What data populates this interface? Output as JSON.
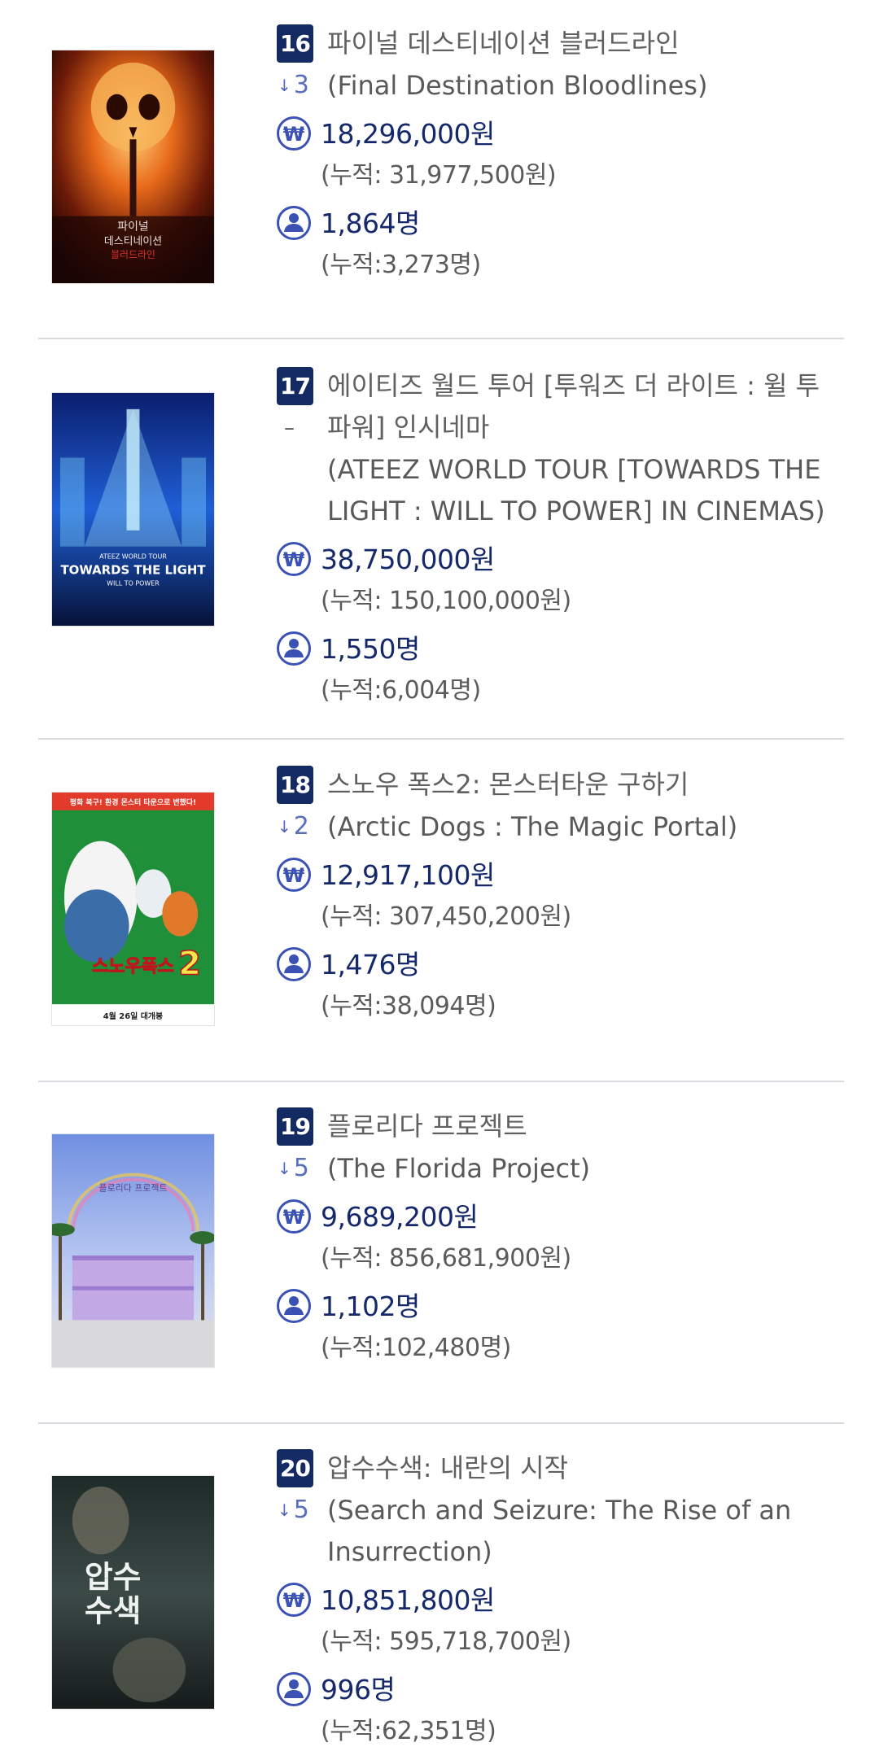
{
  "items": [
    {
      "rank": "16",
      "change": "3",
      "change_dir": "down",
      "title_ko": "파이널 데스티네이션 블러드라인",
      "title_en": "(Final Destination Bloodlines)",
      "sales": "18,296,000원",
      "sales_cum": "(누적: 31,977,500원)",
      "audience": "1,864명",
      "audience_cum": "(누적:3,273명)",
      "poster_icon": "poster-final-destination",
      "poster_text": [
        "파이널",
        "데스티네이션",
        "블러드라인"
      ]
    },
    {
      "rank": "17",
      "change": "–",
      "change_dir": "same",
      "title_ko": "에이티즈 월드 투어 [투워즈 더 라이트 : 윌 투 파워] 인시네마",
      "title_en": "(ATEEZ WORLD TOUR [TOWARDS THE LIGHT : WILL TO POWER] IN CINEMAS)",
      "sales": "38,750,000원",
      "sales_cum": "(누적: 150,100,000원)",
      "audience": "1,550명",
      "audience_cum": "(누적:6,004명)",
      "poster_icon": "poster-ateez",
      "poster_text": [
        "ATEEZ WORLD TOUR",
        "TOWARDS THE LIGHT",
        "WILL TO POWER"
      ]
    },
    {
      "rank": "18",
      "change": "2",
      "change_dir": "down",
      "title_ko": "스노우 폭스2: 몬스터타운 구하기",
      "title_en": "(Arctic Dogs : The Magic Portal)",
      "sales": "12,917,100원",
      "sales_cum": "(누적: 307,450,200원)",
      "audience": "1,476명",
      "audience_cum": "(누적:38,094명)",
      "poster_icon": "poster-arctic-dogs",
      "poster_text": [
        "평화 복구! 환경 몬스터 타운으로 변했다!",
        "스노우폭스",
        "2",
        "4월 26일 대개봉"
      ]
    },
    {
      "rank": "19",
      "change": "5",
      "change_dir": "down",
      "title_ko": "플로리다 프로젝트",
      "title_en": "(The Florida Project)",
      "sales": "9,689,200원",
      "sales_cum": "(누적: 856,681,900원)",
      "audience": "1,102명",
      "audience_cum": "(누적:102,480명)",
      "poster_icon": "poster-florida-project",
      "poster_text": [
        "플로리다 프로젝트"
      ]
    },
    {
      "rank": "20",
      "change": "5",
      "change_dir": "down",
      "title_ko": "압수수색: 내란의 시작",
      "title_en": "(Search and Seizure: The Rise of an Insurrection)",
      "sales": "10,851,800원",
      "sales_cum": "(누적: 595,718,700원)",
      "audience": "996명",
      "audience_cum": "(누적:62,351명)",
      "poster_icon": "poster-search-and-seizure",
      "poster_text": [
        "압수",
        "수색"
      ]
    }
  ],
  "icons": {
    "won": "won-circle-icon",
    "person": "person-circle-icon",
    "arrow_down": "arrow-down-icon"
  },
  "colors": {
    "badge_bg": "#142a63",
    "amount": "#15286b",
    "icon": "#3b52b4",
    "divider": "#d9dadf"
  }
}
